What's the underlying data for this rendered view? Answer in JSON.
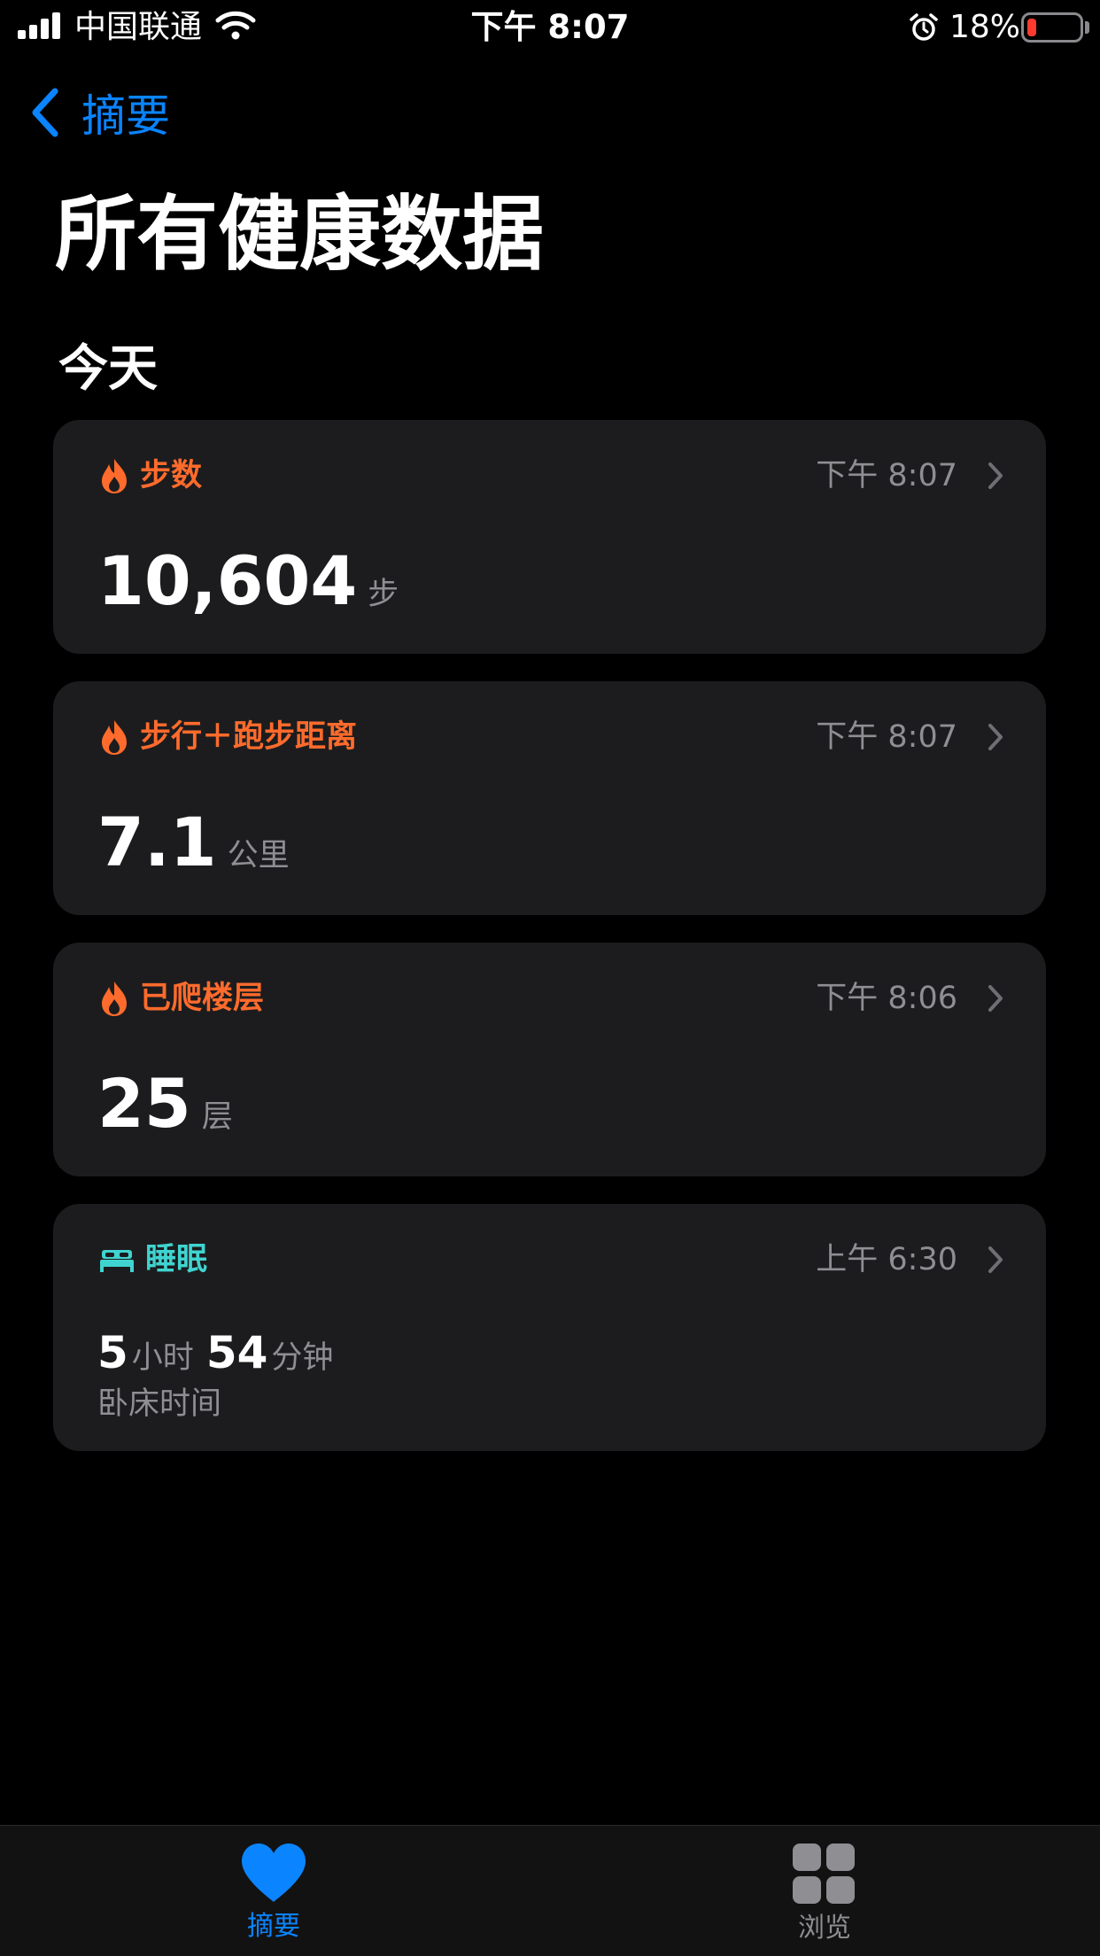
{
  "status_bar": {
    "carrier": "中国联通",
    "time": "下午 8:07",
    "battery_percent": "18%",
    "battery_level": 0.18,
    "icons": [
      "signal-icon",
      "wifi-icon",
      "alarm-icon",
      "battery-icon"
    ]
  },
  "nav": {
    "back_label": "摘要"
  },
  "title": "所有健康数据",
  "section": "今天",
  "colors": {
    "accent_blue": "#0a84ff",
    "activity_orange": "#ff6b2c",
    "sleep_teal": "#40d4d0",
    "card_bg": "#1c1c1e",
    "secondary_text": "#8e8e93"
  },
  "cards": [
    {
      "title": "步数",
      "time": "下午 8:07",
      "value": "10,604",
      "unit": "步",
      "icon": "flame-icon"
    },
    {
      "title": "步行＋跑步距离",
      "time": "下午 8:07",
      "value": "7.1",
      "unit": "公里",
      "icon": "flame-icon"
    },
    {
      "title": "已爬楼层",
      "time": "下午 8:06",
      "value": "25",
      "unit": "层",
      "icon": "flame-icon"
    }
  ],
  "sleep_card": {
    "title": "睡眠",
    "time": "上午 6:30",
    "hours": "5",
    "hours_unit": "小时",
    "minutes": "54",
    "minutes_unit": "分钟",
    "subtitle": "卧床时间",
    "icon": "bed-icon"
  },
  "tabbar": {
    "summary_label": "摘要",
    "browse_label": "浏览",
    "active": "summary"
  }
}
